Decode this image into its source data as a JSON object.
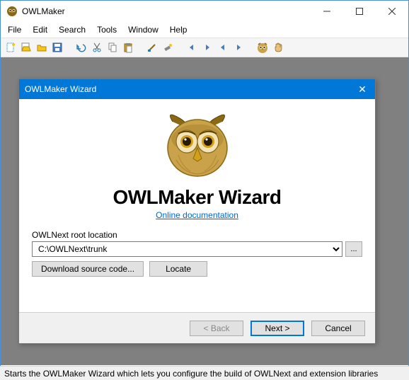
{
  "app": {
    "title": "OWLMaker"
  },
  "menu": {
    "items": [
      "File",
      "Edit",
      "Search",
      "Tools",
      "Window",
      "Help"
    ]
  },
  "wizard": {
    "title": "OWLMaker Wizard",
    "heading": "OWLMaker Wizard",
    "doc_link": "Online documentation",
    "root_label": "OWLNext root location",
    "root_value": "C:\\OWLNext\\trunk",
    "download_btn": "Download source code...",
    "locate_btn": "Locate",
    "back_btn": "< Back",
    "next_btn": "Next >",
    "cancel_btn": "Cancel",
    "browse_btn": "..."
  },
  "statusbar": {
    "text": "Starts the OWLMaker Wizard which lets you configure the build of OWLNext and extension libraries"
  }
}
